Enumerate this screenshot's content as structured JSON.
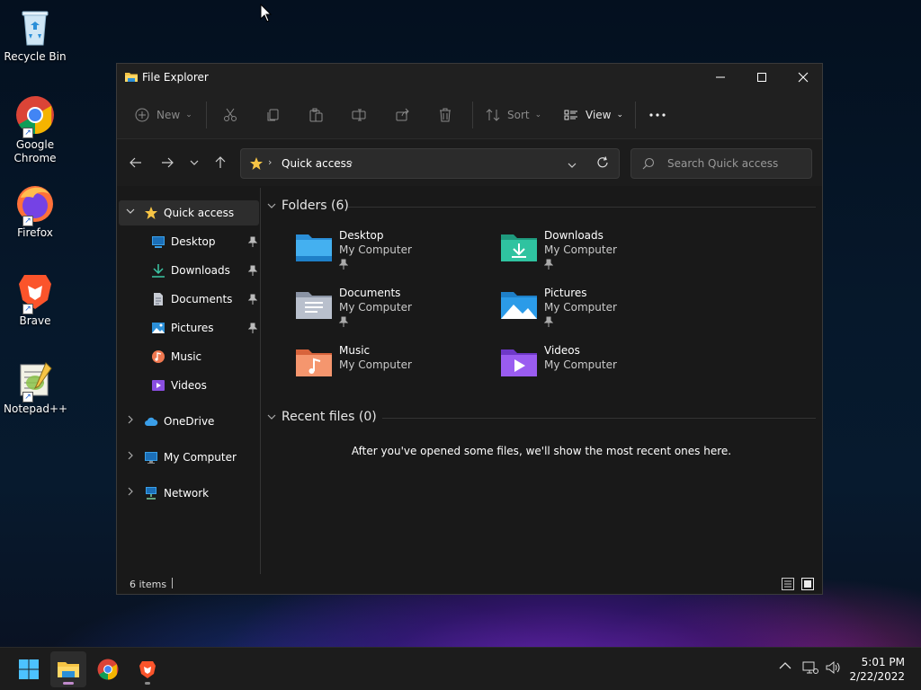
{
  "desktop": {
    "icons": [
      {
        "label": "Recycle Bin"
      },
      {
        "label": "Google Chrome"
      },
      {
        "label": "Firefox"
      },
      {
        "label": "Brave"
      },
      {
        "label": "Notepad++"
      }
    ]
  },
  "window": {
    "title": "File Explorer",
    "toolbar": {
      "new_label": "New",
      "sort_label": "Sort",
      "view_label": "View"
    },
    "address": {
      "location": "Quick access"
    },
    "search": {
      "placeholder": "Search Quick access"
    },
    "sidebar": {
      "quick_access": "Quick access",
      "items": [
        {
          "label": "Desktop"
        },
        {
          "label": "Downloads"
        },
        {
          "label": "Documents"
        },
        {
          "label": "Pictures"
        },
        {
          "label": "Music"
        },
        {
          "label": "Videos"
        }
      ],
      "onedrive": "OneDrive",
      "my_computer": "My Computer",
      "network": "Network"
    },
    "content": {
      "folders_header": "Folders (6)",
      "folders": [
        {
          "name": "Desktop",
          "location": "My Computer"
        },
        {
          "name": "Downloads",
          "location": "My Computer"
        },
        {
          "name": "Documents",
          "location": "My Computer"
        },
        {
          "name": "Pictures",
          "location": "My Computer"
        },
        {
          "name": "Music",
          "location": "My Computer"
        },
        {
          "name": "Videos",
          "location": "My Computer"
        }
      ],
      "recent_header": "Recent files (0)",
      "recent_empty": "After you've opened some files, we'll show the most recent ones here."
    },
    "status": {
      "items": "6 items"
    }
  },
  "taskbar": {
    "time": "5:01 PM",
    "date": "2/22/2022"
  },
  "colors": {
    "accent": "#4cc2ff",
    "folder_yellow": "#f6c445",
    "window_bg": "#191919"
  }
}
